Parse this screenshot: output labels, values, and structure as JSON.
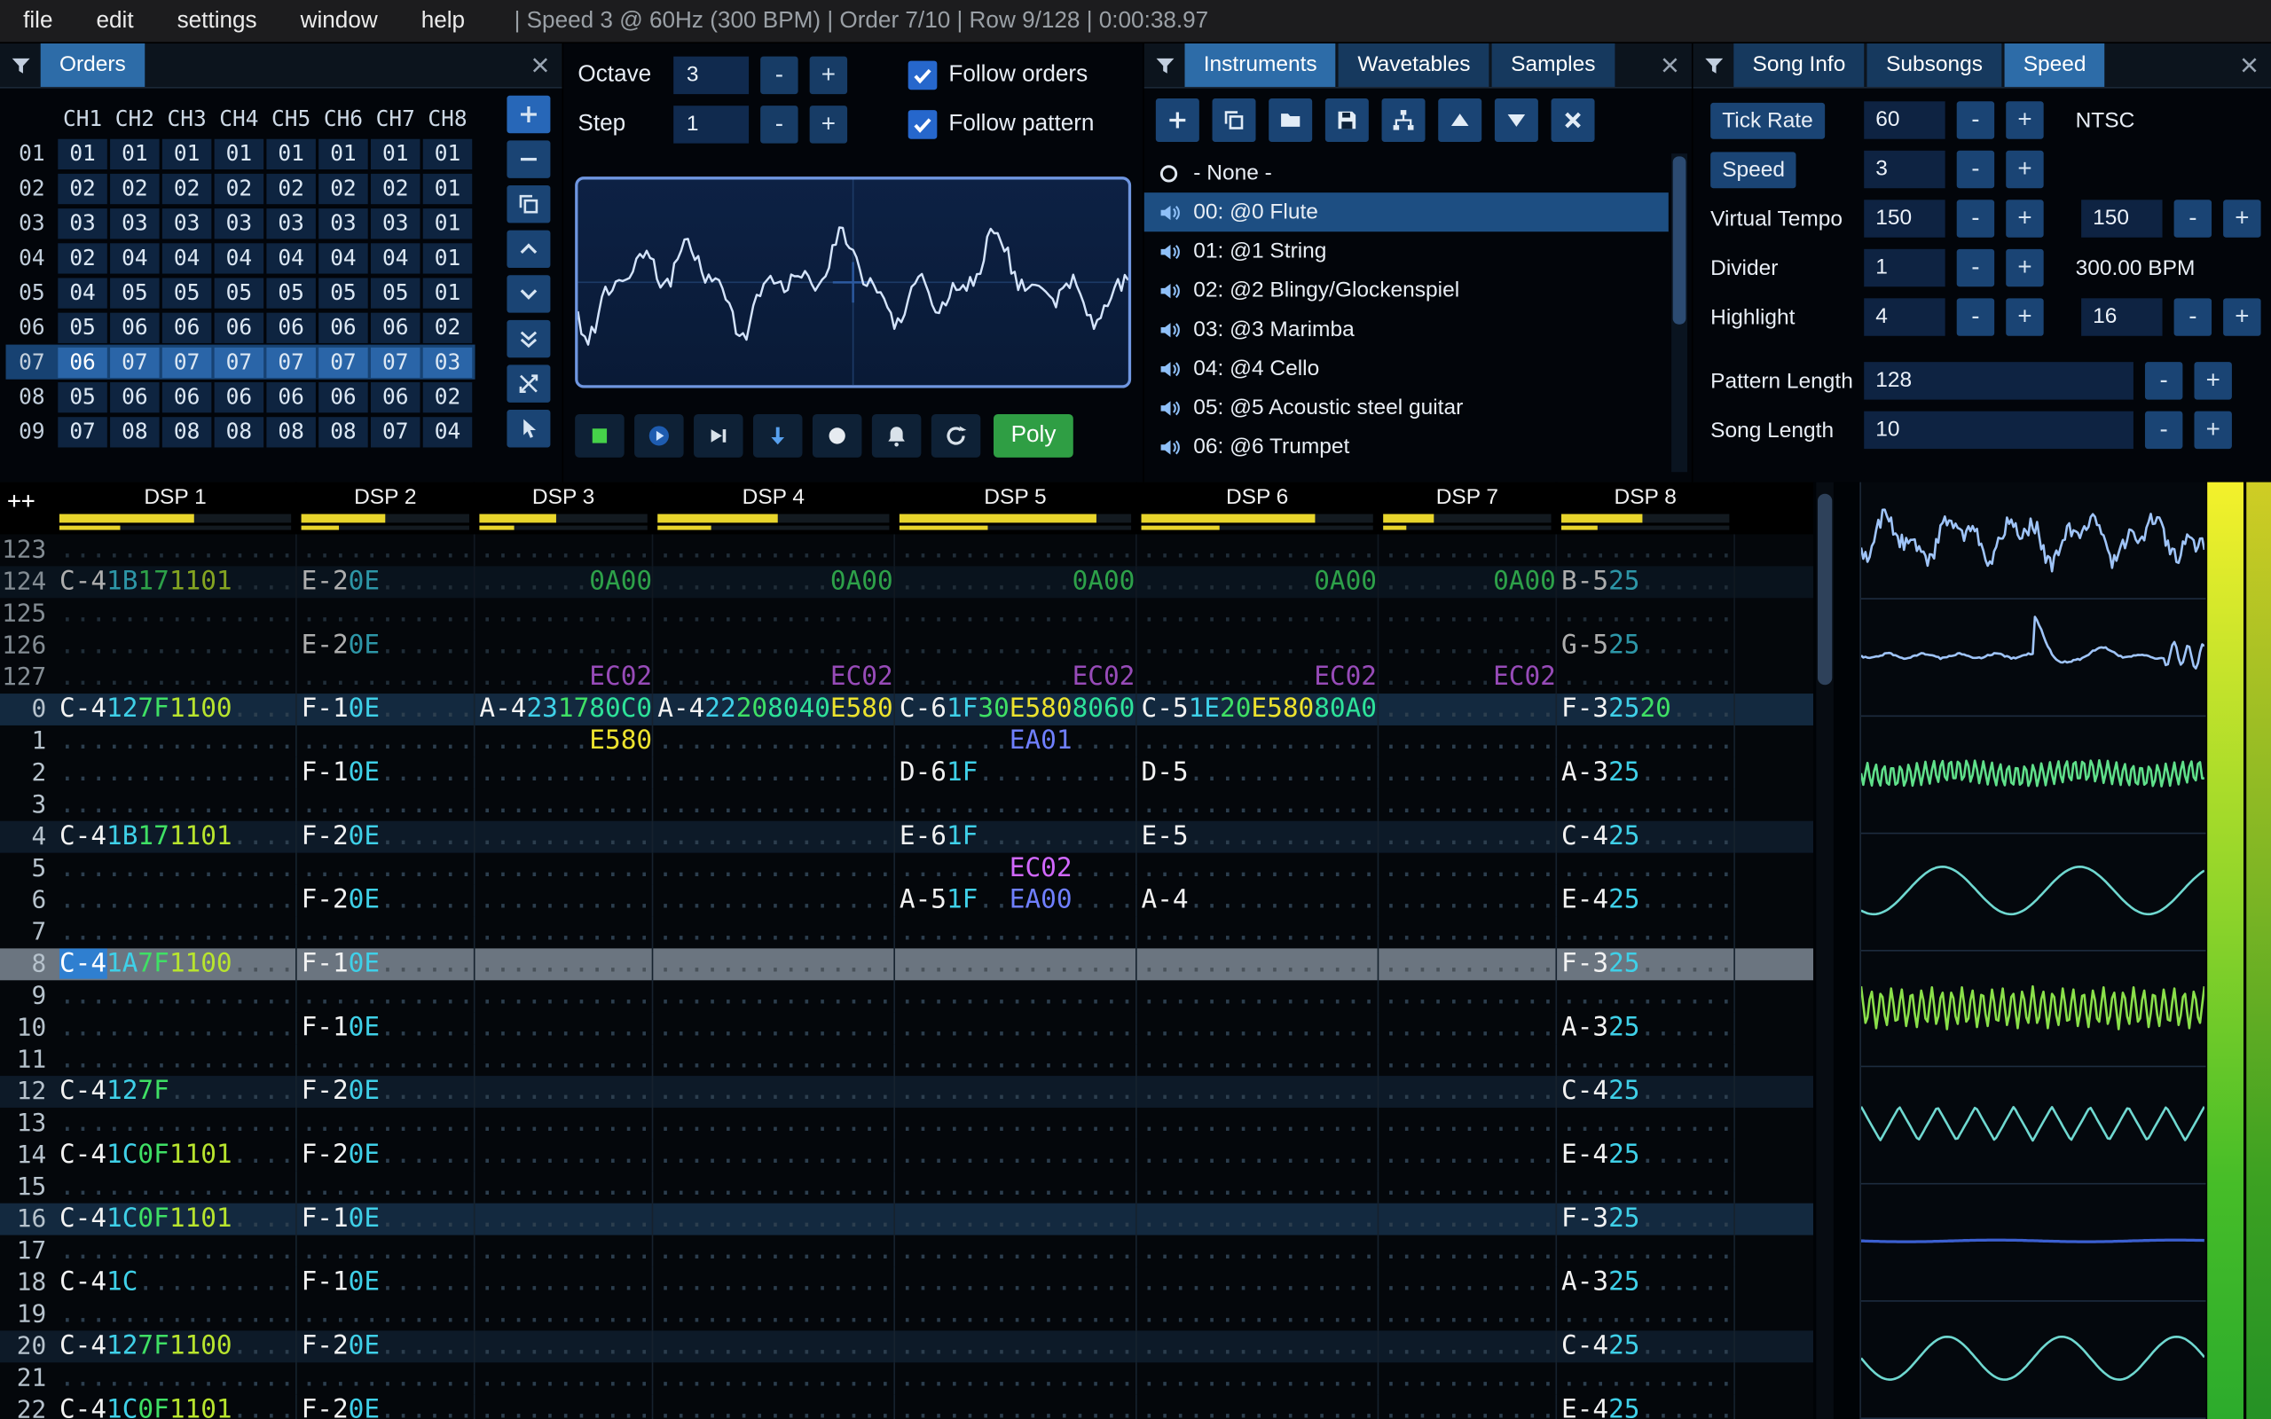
{
  "ui": {
    "minus": "-",
    "plus": "+"
  },
  "menu": {
    "items": [
      "file",
      "edit",
      "settings",
      "window",
      "help"
    ],
    "status": "| Speed 3 @ 60Hz (300 BPM) | Order 7/10 | Row 9/128 | 0:00:38.97"
  },
  "orders": {
    "title": "Orders",
    "channels": [
      "CH1",
      "CH2",
      "CH3",
      "CH4",
      "CH5",
      "CH6",
      "CH7",
      "CH8"
    ],
    "selected_row": 6,
    "cursor_col": 0,
    "rows": [
      {
        "num": "01",
        "vals": [
          "01",
          "01",
          "01",
          "01",
          "01",
          "01",
          "01",
          "01"
        ]
      },
      {
        "num": "02",
        "vals": [
          "02",
          "02",
          "02",
          "02",
          "02",
          "02",
          "02",
          "01"
        ]
      },
      {
        "num": "03",
        "vals": [
          "03",
          "03",
          "03",
          "03",
          "03",
          "03",
          "03",
          "01"
        ]
      },
      {
        "num": "04",
        "vals": [
          "02",
          "04",
          "04",
          "04",
          "04",
          "04",
          "04",
          "01"
        ]
      },
      {
        "num": "05",
        "vals": [
          "04",
          "05",
          "05",
          "05",
          "05",
          "05",
          "05",
          "01"
        ]
      },
      {
        "num": "06",
        "vals": [
          "05",
          "06",
          "06",
          "06",
          "06",
          "06",
          "06",
          "02"
        ]
      },
      {
        "num": "07",
        "vals": [
          "06",
          "07",
          "07",
          "07",
          "07",
          "07",
          "07",
          "03"
        ]
      },
      {
        "num": "08",
        "vals": [
          "05",
          "06",
          "06",
          "06",
          "06",
          "06",
          "06",
          "02"
        ]
      },
      {
        "num": "09",
        "vals": [
          "07",
          "08",
          "08",
          "08",
          "08",
          "08",
          "07",
          "04"
        ]
      }
    ],
    "toolbar": [
      {
        "icon": "plus-icon",
        "name": "add-order-button"
      },
      {
        "icon": "minus-icon",
        "name": "remove-order-button"
      },
      {
        "icon": "duplicate-icon",
        "name": "duplicate-order-button"
      },
      {
        "icon": "chevron-up-icon",
        "name": "move-order-up-button"
      },
      {
        "icon": "chevron-down-icon",
        "name": "move-order-down-button"
      },
      {
        "icon": "double-chevron-down-icon",
        "name": "duplicate-order-end-button"
      },
      {
        "icon": "crossed-arrows-icon",
        "name": "order-change-mode-button"
      },
      {
        "icon": "pointer-icon",
        "name": "order-edit-mode-button"
      }
    ]
  },
  "controls": {
    "octave_label": "Octave",
    "octave_value": "3",
    "step_label": "Step",
    "step_value": "1",
    "follow_orders_label": "Follow orders",
    "follow_orders_checked": true,
    "follow_pattern_label": "Follow pattern",
    "follow_pattern_checked": true,
    "poly_label": "Poly",
    "transport": [
      {
        "icon": "stop-icon",
        "name": "stop-button"
      },
      {
        "icon": "play-icon",
        "name": "play-button"
      },
      {
        "icon": "play-pattern-icon",
        "name": "play-pattern-button"
      },
      {
        "icon": "step-row-icon",
        "name": "step-one-row-button"
      },
      {
        "icon": "record-icon",
        "name": "record-button"
      },
      {
        "icon": "metronome-icon",
        "name": "metronome-button"
      },
      {
        "icon": "repeat-icon",
        "name": "repeat-pattern-button"
      }
    ]
  },
  "instruments": {
    "tabs": [
      "Instruments",
      "Wavetables",
      "Samples"
    ],
    "active_tab": 0,
    "toolbar": [
      {
        "icon": "plus-icon",
        "name": "add-instrument-button"
      },
      {
        "icon": "duplicate-icon",
        "name": "duplicate-instrument-button"
      },
      {
        "icon": "folder-open-icon",
        "name": "open-instrument-button"
      },
      {
        "icon": "save-icon",
        "name": "save-instrument-button"
      },
      {
        "icon": "tree-icon",
        "name": "instrument-folder-button"
      },
      {
        "icon": "triangle-up-icon",
        "name": "move-instrument-up-button"
      },
      {
        "icon": "triangle-down-icon",
        "name": "move-instrument-down-button"
      },
      {
        "icon": "delete-x-icon",
        "name": "delete-instrument-button"
      }
    ],
    "items": [
      {
        "icon": "none-circle-icon",
        "label": "- None -",
        "selected": false
      },
      {
        "icon": "speaker-icon",
        "label": "00: @0 Flute",
        "selected": true
      },
      {
        "icon": "speaker-icon",
        "label": "01: @1 String",
        "selected": false
      },
      {
        "icon": "speaker-icon",
        "label": "02: @2 Blingy/Glockenspiel",
        "selected": false
      },
      {
        "icon": "speaker-icon",
        "label": "03: @3 Marimba",
        "selected": false
      },
      {
        "icon": "speaker-icon",
        "label": "04: @4 Cello",
        "selected": false
      },
      {
        "icon": "speaker-icon",
        "label": "05: @5 Acoustic steel guitar",
        "selected": false
      },
      {
        "icon": "speaker-icon",
        "label": "06: @6 Trumpet",
        "selected": false
      }
    ]
  },
  "song": {
    "tabs": [
      "Song Info",
      "Subsongs",
      "Speed"
    ],
    "active_tab": 2,
    "rows": [
      {
        "label": "Tick Rate",
        "button": true,
        "inputs": [
          "60"
        ],
        "suffix": "NTSC"
      },
      {
        "label": "Speed",
        "button": true,
        "inputs": [
          "3"
        ],
        "suffix": ""
      },
      {
        "label": "Virtual Tempo",
        "button": false,
        "inputs": [
          "150",
          "150"
        ],
        "suffix": ""
      },
      {
        "label": "Divider",
        "button": false,
        "inputs": [
          "1"
        ],
        "suffix": "300.00 BPM"
      },
      {
        "label": "Highlight",
        "button": false,
        "inputs": [
          "4",
          "16"
        ],
        "suffix": ""
      }
    ],
    "length_rows": [
      {
        "label": "Pattern Length",
        "value": "128"
      },
      {
        "label": "Song Length",
        "value": "10"
      }
    ]
  },
  "pattern": {
    "corner_label": "++",
    "cursor": {
      "row_index": 13,
      "channel": 0,
      "field": 0
    },
    "channels": [
      {
        "name": "DSP 1",
        "fields": 5,
        "meter": 0.58
      },
      {
        "name": "DSP 2",
        "fields": 4,
        "meter": 0.5
      },
      {
        "name": "DSP 3",
        "fields": 4,
        "meter": 0.46
      },
      {
        "name": "DSP 4",
        "fields": 5,
        "meter": 0.52
      },
      {
        "name": "DSP 5",
        "fields": 5,
        "meter": 0.85
      },
      {
        "name": "DSP 6",
        "fields": 5,
        "meter": 0.75
      },
      {
        "name": "DSP 7",
        "fields": 4,
        "meter": 0.3
      },
      {
        "name": "DSP 8",
        "fields": 4,
        "meter": 0.48
      }
    ],
    "rows": [
      {
        "n": "123",
        "prev": true,
        "cells": null
      },
      {
        "n": "124",
        "prev": true,
        "cells": [
          [
            "C-4",
            "1B",
            "17",
            "1101",
            ""
          ],
          [
            "E-2",
            "0E",
            "",
            ""
          ],
          [
            "",
            "",
            "",
            "0A00"
          ],
          [
            "",
            "",
            "",
            "",
            "0A00"
          ],
          [
            "",
            "",
            "",
            "",
            "0A00"
          ],
          [
            "",
            "",
            "",
            "",
            "0A00"
          ],
          [
            "",
            "",
            "",
            "0A00"
          ],
          [
            "B-5",
            "25",
            "",
            ""
          ]
        ]
      },
      {
        "n": "125",
        "prev": true,
        "cells": null
      },
      {
        "n": "126",
        "prev": true,
        "cells": [
          null,
          [
            "E-2",
            "0E",
            "",
            ""
          ],
          null,
          null,
          null,
          null,
          null,
          [
            "G-5",
            "25",
            "",
            ""
          ]
        ]
      },
      {
        "n": "127",
        "prev": true,
        "cells": [
          null,
          null,
          [
            "",
            "",
            "",
            "EC02"
          ],
          [
            "",
            "",
            "",
            "",
            "EC02"
          ],
          [
            "",
            "",
            "",
            "",
            "EC02"
          ],
          [
            "",
            "",
            "",
            "",
            "EC02"
          ],
          [
            "",
            "",
            "",
            "EC02"
          ],
          null
        ]
      },
      {
        "n": "0",
        "cells": [
          [
            "C-4",
            "12",
            "7F",
            "1100",
            ""
          ],
          [
            "F-1",
            "0E",
            "",
            ""
          ],
          [
            "A-4",
            "23",
            "17",
            "80C0"
          ],
          [
            "A-4",
            "22",
            "20",
            "8040",
            "E580"
          ],
          [
            "C-6",
            "1F",
            "30",
            "E580",
            "8060"
          ],
          [
            "C-5",
            "1E",
            "20",
            "E580",
            "80A0"
          ],
          null,
          [
            "F-3",
            "25",
            "20",
            ""
          ]
        ]
      },
      {
        "n": "1",
        "cells": [
          null,
          null,
          [
            "",
            "",
            "",
            "E580"
          ],
          null,
          [
            "",
            "",
            "",
            "EA01",
            ""
          ],
          null,
          null,
          null
        ]
      },
      {
        "n": "2",
        "cells": [
          null,
          [
            "F-1",
            "0E",
            "",
            ""
          ],
          null,
          null,
          [
            "D-6",
            "1F",
            "",
            "",
            ""
          ],
          [
            "D-5",
            "",
            "",
            "",
            ""
          ],
          null,
          [
            "A-3",
            "25",
            "",
            ""
          ]
        ]
      },
      {
        "n": "3",
        "cells": null
      },
      {
        "n": "4",
        "cells": [
          [
            "C-4",
            "1B",
            "17",
            "1101",
            ""
          ],
          [
            "F-2",
            "0E",
            "",
            ""
          ],
          null,
          null,
          [
            "E-6",
            "1F",
            "",
            "",
            ""
          ],
          [
            "E-5",
            "",
            "",
            "",
            ""
          ],
          null,
          [
            "C-4",
            "25",
            "",
            ""
          ]
        ]
      },
      {
        "n": "5",
        "cells": [
          null,
          null,
          null,
          null,
          [
            "",
            "",
            "",
            "EC02",
            ""
          ],
          null,
          null,
          null
        ]
      },
      {
        "n": "6",
        "cells": [
          null,
          [
            "F-2",
            "0E",
            "",
            ""
          ],
          null,
          null,
          [
            "A-5",
            "1F",
            "",
            "EA00",
            ""
          ],
          [
            "A-4",
            "",
            "",
            "",
            ""
          ],
          null,
          [
            "E-4",
            "25",
            "",
            ""
          ]
        ]
      },
      {
        "n": "7",
        "cells": null
      },
      {
        "n": "8",
        "cells": [
          [
            "C-4",
            "1A",
            "7F",
            "1100",
            ""
          ],
          [
            "F-1",
            "0E",
            "",
            ""
          ],
          null,
          null,
          null,
          null,
          null,
          [
            "F-3",
            "25",
            "",
            ""
          ]
        ]
      },
      {
        "n": "9",
        "cells": null
      },
      {
        "n": "10",
        "cells": [
          null,
          [
            "F-1",
            "0E",
            "",
            ""
          ],
          null,
          null,
          null,
          null,
          null,
          [
            "A-3",
            "25",
            "",
            ""
          ]
        ]
      },
      {
        "n": "11",
        "cells": null
      },
      {
        "n": "12",
        "cells": [
          [
            "C-4",
            "12",
            "7F",
            "",
            ""
          ],
          [
            "F-2",
            "0E",
            "",
            ""
          ],
          null,
          null,
          null,
          null,
          null,
          [
            "C-4",
            "25",
            "",
            ""
          ]
        ]
      },
      {
        "n": "13",
        "cells": null
      },
      {
        "n": "14",
        "cells": [
          [
            "C-4",
            "1C",
            "0F",
            "1101",
            ""
          ],
          [
            "F-2",
            "0E",
            "",
            ""
          ],
          null,
          null,
          null,
          null,
          null,
          [
            "E-4",
            "25",
            "",
            ""
          ]
        ]
      },
      {
        "n": "15",
        "cells": null
      },
      {
        "n": "16",
        "cells": [
          [
            "C-4",
            "1C",
            "0F",
            "1101",
            ""
          ],
          [
            "F-1",
            "0E",
            "",
            ""
          ],
          null,
          null,
          null,
          null,
          null,
          [
            "F-3",
            "25",
            "",
            ""
          ]
        ]
      },
      {
        "n": "17",
        "cells": null
      },
      {
        "n": "18",
        "cells": [
          [
            "C-4",
            "1C",
            "",
            "",
            ""
          ],
          [
            "F-1",
            "0E",
            "",
            ""
          ],
          null,
          null,
          null,
          null,
          null,
          [
            "A-3",
            "25",
            "",
            ""
          ]
        ]
      },
      {
        "n": "19",
        "cells": null
      },
      {
        "n": "20",
        "cells": [
          [
            "C-4",
            "12",
            "7F",
            "1100",
            ""
          ],
          [
            "F-2",
            "0E",
            "",
            ""
          ],
          null,
          null,
          null,
          null,
          null,
          [
            "C-4",
            "25",
            "",
            ""
          ]
        ]
      },
      {
        "n": "21",
        "cells": null
      },
      {
        "n": "22",
        "cells": [
          [
            "C-4",
            "1C",
            "0F",
            "1101",
            ""
          ],
          [
            "F-2",
            "0E",
            "",
            ""
          ],
          null,
          null,
          null,
          null,
          null,
          [
            "E-4",
            "25",
            "",
            ""
          ]
        ]
      }
    ]
  },
  "scopes": [
    {
      "type": "noise",
      "color": "#9fc4f8"
    },
    {
      "type": "spike",
      "color": "#9fc4f8"
    },
    {
      "type": "dense",
      "color": "#5fe08a"
    },
    {
      "type": "sine",
      "color": "#6fd8d0"
    },
    {
      "type": "densezig",
      "color": "#8ae04a"
    },
    {
      "type": "zigzag",
      "color": "#6fd8d0"
    },
    {
      "type": "flat",
      "color": "#3b5fd0"
    },
    {
      "type": "sine2",
      "color": "#6fd8d0"
    }
  ],
  "colors": {
    "accent": "#2d6ca8",
    "note": "#f2f2f2",
    "instrument": "#3fd0e8",
    "volume": "#3fe065",
    "fx_pitch": "#ece22e",
    "fx_cut": "#d268ff",
    "fx_legato": "#6f7fff",
    "fx_misc": "#b8e42e",
    "fx_volslide": "#3fe065",
    "fx_pan": "#2ee29a",
    "meter_yellow": "#e8d52c"
  }
}
